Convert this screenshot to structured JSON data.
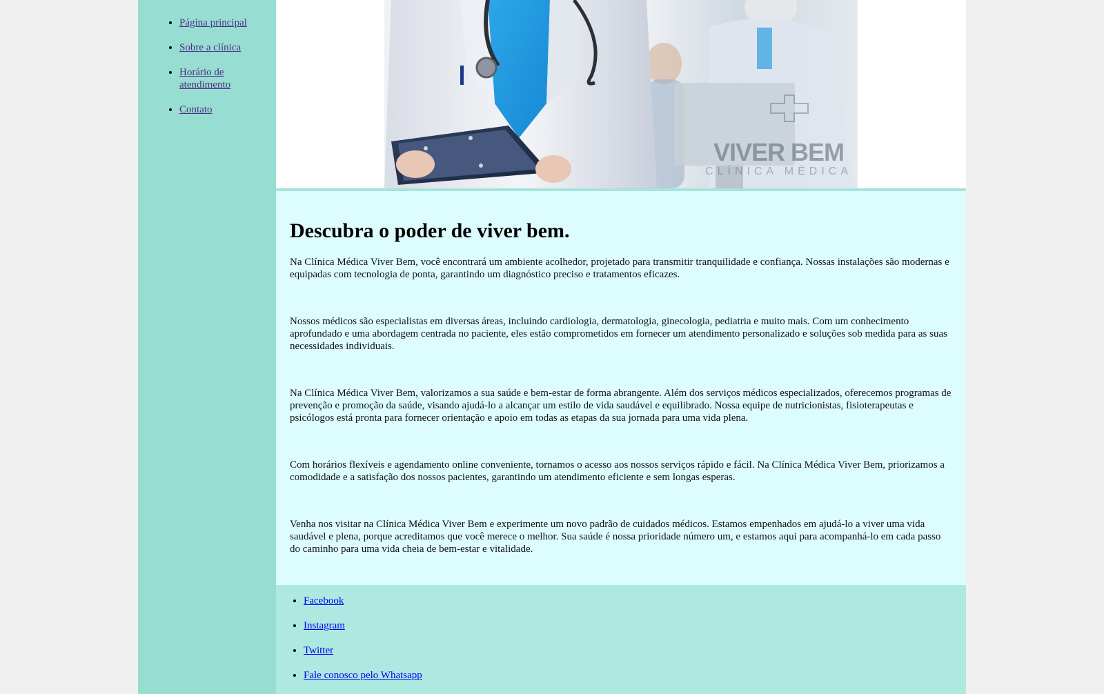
{
  "sidebar": {
    "items": [
      {
        "label": "Página principal"
      },
      {
        "label": "Sobre a clínica"
      },
      {
        "label": "Horário de atendimento"
      },
      {
        "label": "Contato"
      }
    ]
  },
  "banner": {
    "image": "doctor-with-clipboard-photo",
    "watermark_title": "VIVER BEM",
    "watermark_subtitle": "CLÍNICA MÉDICA"
  },
  "main": {
    "heading": "Descubra o poder de viver bem.",
    "paragraphs": [
      "Na Clínica Médica Viver Bem, você encontrará um ambiente acolhedor, projetado para transmitir tranquilidade e confiança. Nossas instalações são modernas e equipadas com tecnologia de ponta, garantindo um diagnóstico preciso e tratamentos eficazes.",
      "Nossos médicos são especialistas em diversas áreas, incluindo cardiologia, dermatologia, ginecologia, pediatria e muito mais. Com um conhecimento aprofundado e uma abordagem centrada no paciente, eles estão comprometidos em fornecer um atendimento personalizado e soluções sob medida para as suas necessidades individuais.",
      "Na Clínica Médica Viver Bem, valorizamos a sua saúde e bem-estar de forma abrangente. Além dos serviços médicos especializados, oferecemos programas de prevenção e promoção da saúde, visando ajudá-lo a alcançar um estilo de vida saudável e equilibrado. Nossa equipe de nutricionistas, fisioterapeutas e psicólogos está pronta para fornecer orientação e apoio em todas as etapas da sua jornada para uma vida plena.",
      "Com horários flexíveis e agendamento online conveniente, tornamos o acesso aos nossos serviços rápido e fácil. Na Clínica Médica Viver Bem, priorizamos a comodidade e a satisfação dos nossos pacientes, garantindo um atendimento eficiente e sem longas esperas.",
      "Venha nos visitar na Clínica Médica Viver Bem e experimente um novo padrão de cuidados médicos. Estamos empenhados em ajudá-lo a viver uma vida saudável e plena, porque acreditamos que você merece o melhor. Sua saúde é nossa prioridade número um, e estamos aqui para acompanhá-lo em cada passo do caminho para uma vida cheia de bem-estar e vitalidade."
    ]
  },
  "footer": {
    "links": [
      {
        "label": "Facebook"
      },
      {
        "label": "Instagram"
      },
      {
        "label": "Twitter"
      },
      {
        "label": "Fale conosco pelo Whatsapp"
      }
    ]
  },
  "colors": {
    "sidebar_bg": "#98ddd1",
    "content_bg": "#ddfcfd",
    "footer_bg": "#aee9e1",
    "visited_link": "#4b2d86",
    "link": "#0000ee"
  }
}
